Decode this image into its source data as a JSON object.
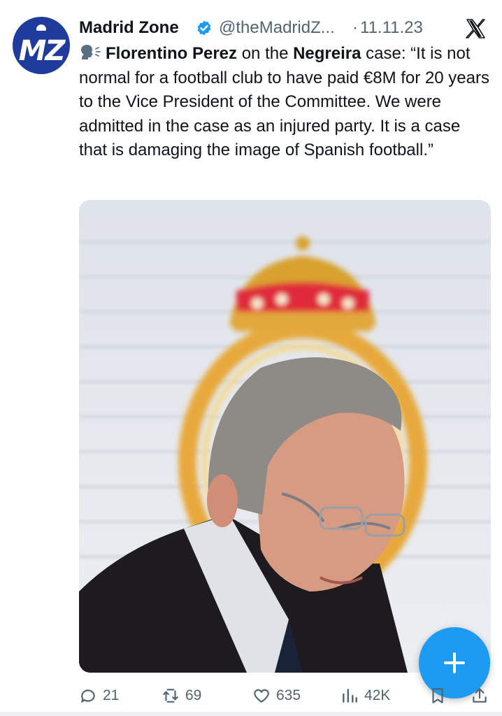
{
  "tweet": {
    "author_name": "Madrid Zone",
    "handle": "@theMadridZ...",
    "separator": "·",
    "date": "11.11.23",
    "avatar_text": "MZ",
    "text": {
      "part1_name": "Florentino Perez",
      "part2": " on the ",
      "part3_topic": "Negreira",
      "part4": " case: “It is not normal for a football club to have paid €8M for 20 years to the Vice President of the Committee. We were admitted in the case as an injured party. It is a case that is damaging the image of Spanish football.”"
    }
  },
  "actions": {
    "replies": "21",
    "reposts": "69",
    "likes": "635",
    "views": "42K"
  },
  "icons": {
    "verified": "verified-badge-icon",
    "platform": "x-logo-icon",
    "speaking": "speaking-head-icon",
    "compose": "plus-icon"
  },
  "colors": {
    "accent": "#1d9bf0",
    "avatar_bg": "#1f3b9c",
    "muted": "#536471",
    "text": "#0f1419"
  }
}
